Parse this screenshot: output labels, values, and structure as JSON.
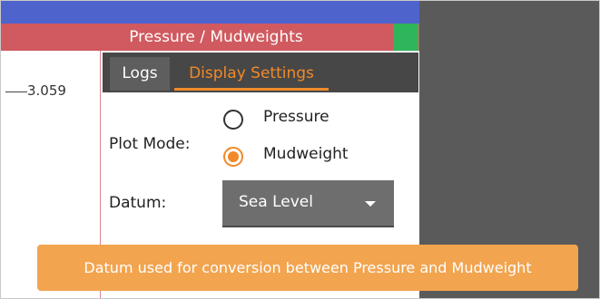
{
  "window": {
    "title": "Pressure / Mudweights",
    "accent_color": "#f08a2a"
  },
  "plot": {
    "tick_label": "3.059"
  },
  "tabs": [
    {
      "label": "Logs",
      "active": false
    },
    {
      "label": "Display Settings",
      "active": true
    }
  ],
  "settings": {
    "plot_mode_label": "Plot Mode:",
    "plot_mode_options": [
      {
        "label": "Pressure",
        "selected": false
      },
      {
        "label": "Mudweight",
        "selected": true
      }
    ],
    "datum_label": "Datum:",
    "datum_value": "Sea Level"
  },
  "tooltip": {
    "text": "Datum used for conversion between Pressure and Mudweight"
  }
}
